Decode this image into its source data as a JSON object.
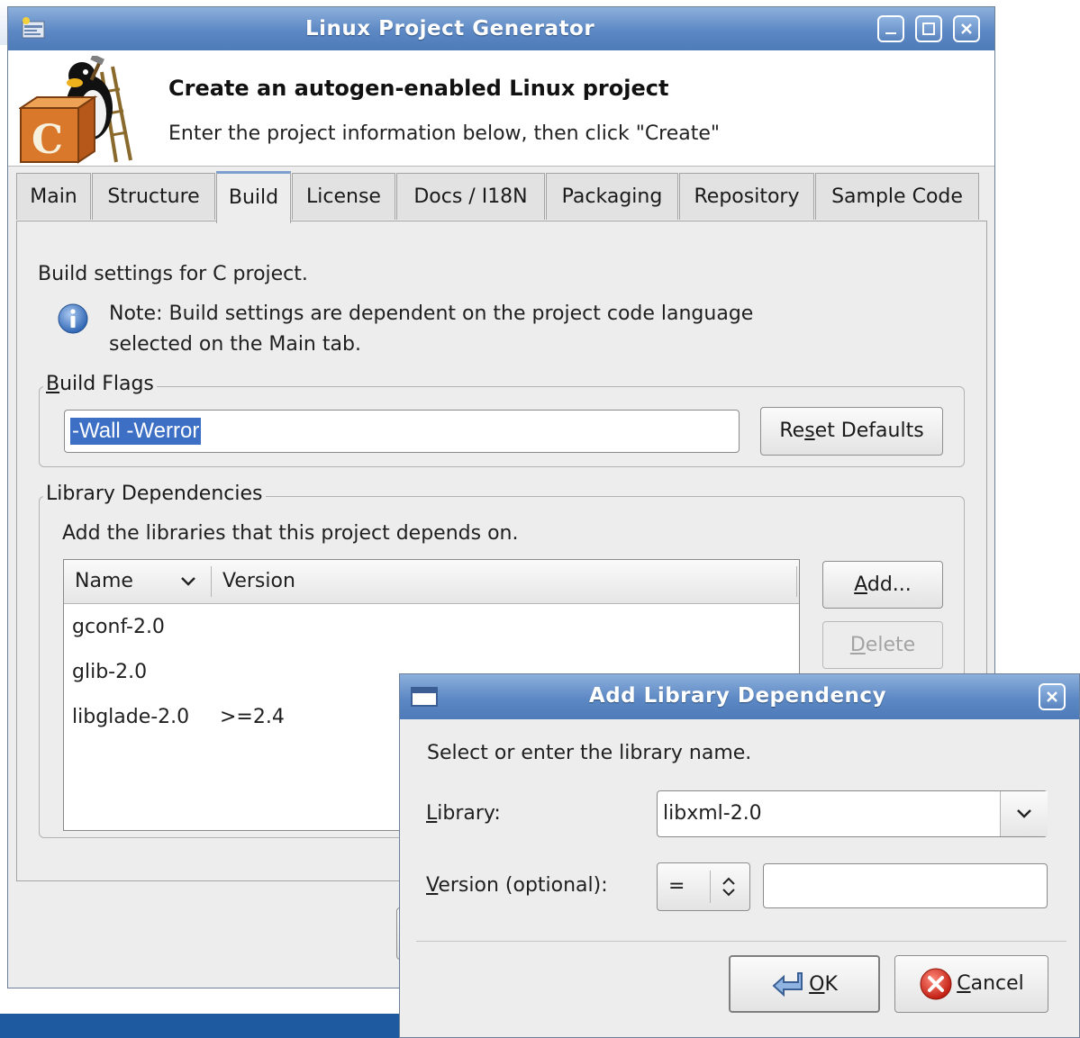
{
  "main_window": {
    "title": "Linux Project Generator",
    "header": {
      "title": "Create an autogen-enabled Linux project",
      "subtitle": "Enter the project information below, then click \"Create\""
    },
    "tabs": [
      "Main",
      "Structure",
      "Build",
      "License",
      "Docs / I18N",
      "Packaging",
      "Repository",
      "Sample Code"
    ],
    "active_tab": "Build",
    "build": {
      "heading": "Build settings for C project.",
      "note_line1": "Note: Build settings are dependent on the project code language",
      "note_line2": "selected on the Main tab.",
      "build_flags": {
        "label_u": "B",
        "label_rest": "uild Flags",
        "value": "-Wall -Werror",
        "reset_pre": "Re",
        "reset_u": "s",
        "reset_post": "et Defaults"
      },
      "library_deps": {
        "label": "Library Dependencies",
        "description": "Add the libraries that this project depends on.",
        "columns": [
          "Name",
          "Version"
        ],
        "rows": [
          {
            "name": "gconf-2.0",
            "version": ""
          },
          {
            "name": "glib-2.0",
            "version": ""
          },
          {
            "name": "libglade-2.0",
            "version": ">=2.4"
          }
        ],
        "add_u": "A",
        "add_rest": "dd...",
        "delete_u": "D",
        "delete_rest": "elete"
      }
    }
  },
  "dialog": {
    "title": "Add Library Dependency",
    "prompt": "Select or enter the library name.",
    "library_label_u": "L",
    "library_label_rest": "ibrary:",
    "library_value": "libxml-2.0",
    "version_label_u": "V",
    "version_label_rest": "ersion (optional):",
    "version_operator": "=",
    "version_value": "",
    "ok_u": "O",
    "ok_rest": "K",
    "cancel_u": "C",
    "cancel_rest": "ancel"
  },
  "colors": {
    "titlebar": "#5c88c4",
    "selection": "#3d6fc4",
    "taskbar": "#1d5aa0",
    "cancel_icon": "#d42a1e"
  }
}
